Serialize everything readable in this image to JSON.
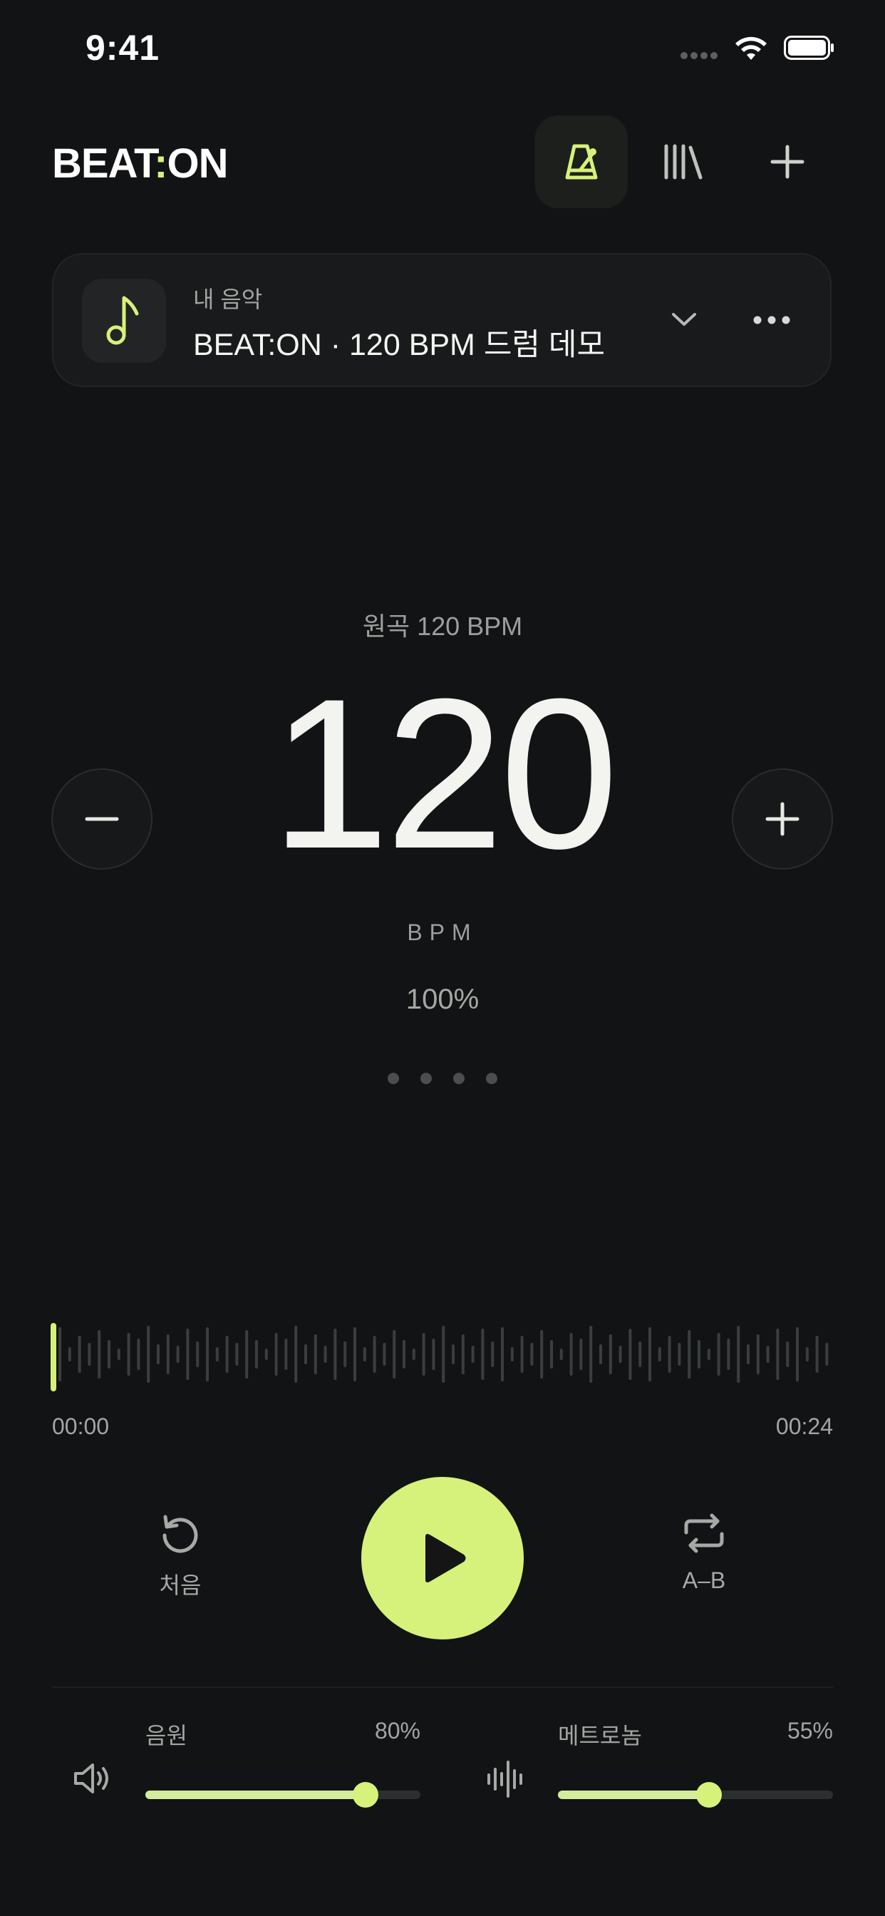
{
  "status_bar": {
    "time": "9:41"
  },
  "header": {
    "logo_left": "BEAT",
    "logo_colon": ":",
    "logo_right": "ON"
  },
  "track": {
    "subtitle": "내 음악",
    "title": "BEAT:ON · 120 BPM 드럼 데모"
  },
  "tempo": {
    "original": "원곡 120 BPM",
    "bpm": "120",
    "unit": "BPM",
    "percent": "100%",
    "beats_per_bar": 4
  },
  "timeline": {
    "start": "00:00",
    "end": "00:24"
  },
  "controls": {
    "restart_label": "처음",
    "ab_label": "A–B"
  },
  "mixer": {
    "source": {
      "label": "음원",
      "value_text": "80%",
      "level": 0.8
    },
    "metronome": {
      "label": "메트로놈",
      "value_text": "55%",
      "level": 0.55
    }
  },
  "colors": {
    "accent": "#d6f27a",
    "background": "#121315"
  }
}
